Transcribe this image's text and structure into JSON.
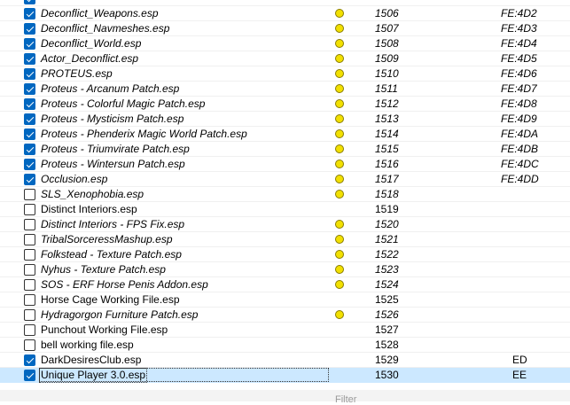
{
  "plugins": [
    {
      "name": "",
      "checked": true,
      "esp": true,
      "flag": false,
      "index": "",
      "form_id": ""
    },
    {
      "name": "Deconflict_Weapons.esp",
      "checked": true,
      "esp": true,
      "flag": true,
      "index": "1506",
      "form_id": "FE:4D2"
    },
    {
      "name": "Deconflict_Navmeshes.esp",
      "checked": true,
      "esp": true,
      "flag": true,
      "index": "1507",
      "form_id": "FE:4D3"
    },
    {
      "name": "Deconflict_World.esp",
      "checked": true,
      "esp": true,
      "flag": true,
      "index": "1508",
      "form_id": "FE:4D4"
    },
    {
      "name": "Actor_Deconflict.esp",
      "checked": true,
      "esp": true,
      "flag": true,
      "index": "1509",
      "form_id": "FE:4D5"
    },
    {
      "name": "PROTEUS.esp",
      "checked": true,
      "esp": true,
      "flag": true,
      "index": "1510",
      "form_id": "FE:4D6"
    },
    {
      "name": "Proteus - Arcanum Patch.esp",
      "checked": true,
      "esp": true,
      "flag": true,
      "index": "1511",
      "form_id": "FE:4D7"
    },
    {
      "name": "Proteus - Colorful Magic Patch.esp",
      "checked": true,
      "esp": true,
      "flag": true,
      "index": "1512",
      "form_id": "FE:4D8"
    },
    {
      "name": "Proteus - Mysticism Patch.esp",
      "checked": true,
      "esp": true,
      "flag": true,
      "index": "1513",
      "form_id": "FE:4D9"
    },
    {
      "name": "Proteus - Phenderix Magic World Patch.esp",
      "checked": true,
      "esp": true,
      "flag": true,
      "index": "1514",
      "form_id": "FE:4DA"
    },
    {
      "name": "Proteus - Triumvirate Patch.esp",
      "checked": true,
      "esp": true,
      "flag": true,
      "index": "1515",
      "form_id": "FE:4DB"
    },
    {
      "name": "Proteus - Wintersun Patch.esp",
      "checked": true,
      "esp": true,
      "flag": true,
      "index": "1516",
      "form_id": "FE:4DC"
    },
    {
      "name": "Occlusion.esp",
      "checked": true,
      "esp": true,
      "flag": true,
      "index": "1517",
      "form_id": "FE:4DD"
    },
    {
      "name": "SLS_Xenophobia.esp",
      "checked": false,
      "esp": true,
      "flag": true,
      "index": "1518",
      "form_id": ""
    },
    {
      "name": "Distinct Interiors.esp",
      "checked": false,
      "esp": false,
      "flag": false,
      "index": "1519",
      "form_id": ""
    },
    {
      "name": "Distinct Interiors - FPS Fix.esp",
      "checked": false,
      "esp": true,
      "flag": true,
      "index": "1520",
      "form_id": ""
    },
    {
      "name": "TribalSorceressMashup.esp",
      "checked": false,
      "esp": true,
      "flag": true,
      "index": "1521",
      "form_id": ""
    },
    {
      "name": "Folkstead - Texture Patch.esp",
      "checked": false,
      "esp": true,
      "flag": true,
      "index": "1522",
      "form_id": ""
    },
    {
      "name": "Nyhus - Texture Patch.esp",
      "checked": false,
      "esp": true,
      "flag": true,
      "index": "1523",
      "form_id": ""
    },
    {
      "name": "SOS - ERF Horse Penis Addon.esp",
      "checked": false,
      "esp": true,
      "flag": true,
      "index": "1524",
      "form_id": ""
    },
    {
      "name": "Horse Cage Working File.esp",
      "checked": false,
      "esp": false,
      "flag": false,
      "index": "1525",
      "form_id": ""
    },
    {
      "name": "Hydragorgon Furniture Patch.esp",
      "checked": false,
      "esp": true,
      "flag": true,
      "index": "1526",
      "form_id": ""
    },
    {
      "name": "Punchout Working File.esp",
      "checked": false,
      "esp": false,
      "flag": false,
      "index": "1527",
      "form_id": ""
    },
    {
      "name": "bell working file.esp",
      "checked": false,
      "esp": false,
      "flag": false,
      "index": "1528",
      "form_id": ""
    },
    {
      "name": "DarkDesiresClub.esp",
      "checked": true,
      "esp": false,
      "flag": false,
      "index": "1529",
      "form_id": "ED"
    },
    {
      "name": "Unique Player 3.0.esp",
      "checked": true,
      "esp": false,
      "flag": false,
      "index": "1530",
      "form_id": "EE",
      "selected": true
    }
  ],
  "filter": {
    "placeholder": "Filter"
  },
  "colors": {
    "checkbox_checked": "#0067c0",
    "flag_yellow": "#f2e000",
    "selection": "#cce8ff"
  }
}
